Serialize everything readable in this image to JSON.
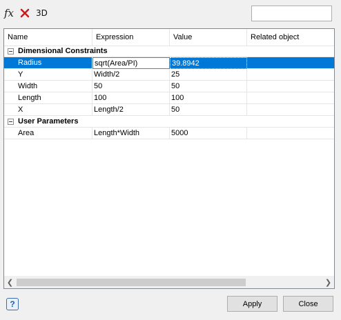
{
  "toolbar": {
    "fx_label": "fx",
    "delete_icon": "delete-x-icon",
    "view3d_label": "3D"
  },
  "filter": {
    "value": ""
  },
  "columns": [
    "Name",
    "Expression",
    "Value",
    "Related object"
  ],
  "groups": [
    {
      "title": "Dimensional Constraints",
      "rows": [
        {
          "name": "Radius",
          "expr": "sqrt(Area/PI)",
          "value": "39.8942",
          "related": ""
        },
        {
          "name": "Y",
          "expr": "Width/2",
          "value": "25",
          "related": ""
        },
        {
          "name": "Width",
          "expr": "50",
          "value": "50",
          "related": ""
        },
        {
          "name": "Length",
          "expr": "100",
          "value": "100",
          "related": ""
        },
        {
          "name": "X",
          "expr": "Length/2",
          "value": "50",
          "related": ""
        }
      ]
    },
    {
      "title": "User Parameters",
      "rows": [
        {
          "name": "Area",
          "expr": "Length*Width",
          "value": "5000",
          "related": ""
        }
      ]
    }
  ],
  "footer": {
    "help_label": "?",
    "apply_label": "Apply",
    "close_label": "Close"
  },
  "colors": {
    "selection": "#0078d7"
  }
}
